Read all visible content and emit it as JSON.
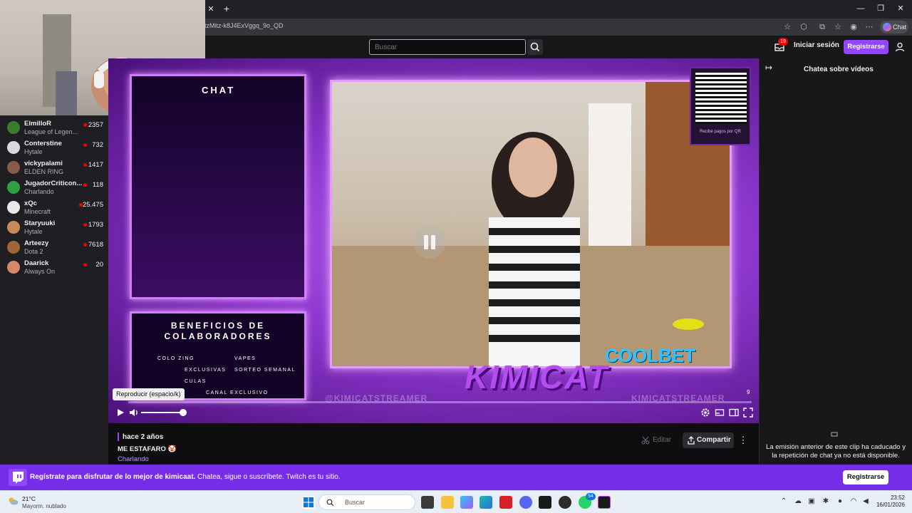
{
  "browser": {
    "url": "tzMitz-k8J4ExVggq_9o_QD",
    "copilot_label": "Chat",
    "close_glyph": "✕",
    "new_tab_glyph": "+",
    "minimize_glyph": "—",
    "restore_glyph": "❐",
    "close_window_glyph": "✕"
  },
  "topnav": {
    "search_placeholder": "Buscar",
    "notification_count": "19",
    "login_label": "Iniciar sesión",
    "signup_label": "Registrarse"
  },
  "sidebar": {
    "channels": [
      {
        "name": "ElmilloR",
        "game": "League of Legen...",
        "viewers": "2357",
        "color": "#3a7d2c"
      },
      {
        "name": "Conterstine",
        "game": "Hytale",
        "viewers": "732",
        "color": "#d9d9d9"
      },
      {
        "name": "vickypalami",
        "game": "ELDEN RING",
        "viewers": "1417",
        "color": "#8a5a48"
      },
      {
        "name": "JugadorCriticon...",
        "game": "Charlando",
        "viewers": "118",
        "color": "#2f9e44"
      },
      {
        "name": "xQc",
        "game": "Minecraft",
        "viewers": "25.475",
        "color": "#e9e9e9"
      },
      {
        "name": "Staryuuki",
        "game": "Hytale",
        "viewers": "1793",
        "color": "#c78a5b"
      },
      {
        "name": "Arteezy",
        "game": "Dota 2",
        "viewers": "7618",
        "color": "#a0663a"
      },
      {
        "name": "Daarick",
        "game": "Always On",
        "viewers": "20",
        "color": "#d6876a"
      }
    ]
  },
  "player": {
    "tooltip": "Reproducir (espacio/k)",
    "time_marker": "9",
    "brand_text": "KIMICAT",
    "sponsor_text": "COOLBET",
    "qr_caption": "Recibe pagos por QR",
    "overlay_chat_label": "CHAT",
    "benefits_title": "BENEFICIOS DE COLABORADORES",
    "benefits_items": [
      "COLO ZING",
      "VAPES",
      "EXCLUSIVAS",
      "SORTEO SEMANAL",
      "CULAS",
      "CANAL EXCLUSIVO"
    ],
    "social_handle_left": "@KIMICATSTREAMER",
    "social_handle_right": "KIMICATSTREAMER",
    "volume": 0.95
  },
  "clip": {
    "time_ago": "hace 2 años",
    "title": "ME ESTAFARO 🤡",
    "category": "Charlando",
    "edit_label": "Editar",
    "share_label": "Compartir"
  },
  "chat": {
    "title": "Chatea sobre vídeos",
    "message": "La emisión anterior de este clip ha caducado y la repetición de chat ya no está disponible."
  },
  "banner": {
    "bold_text": "Regístrate para disfrutar de lo mejor de kimicaat.",
    "text": "Chatea, sigue o suscríbete. Twitch es tu sitio.",
    "button": "Registrarse"
  },
  "taskbar": {
    "weather_temp": "21°C",
    "weather_desc": "Mayorm. nublado",
    "search_placeholder": "Buscar",
    "time": "23:52",
    "date": "16/01/2026",
    "badge_count": "54"
  },
  "colors": {
    "twitch_purple": "#9147ff",
    "banner_purple": "#772ce8",
    "live_red": "#eb0400"
  }
}
